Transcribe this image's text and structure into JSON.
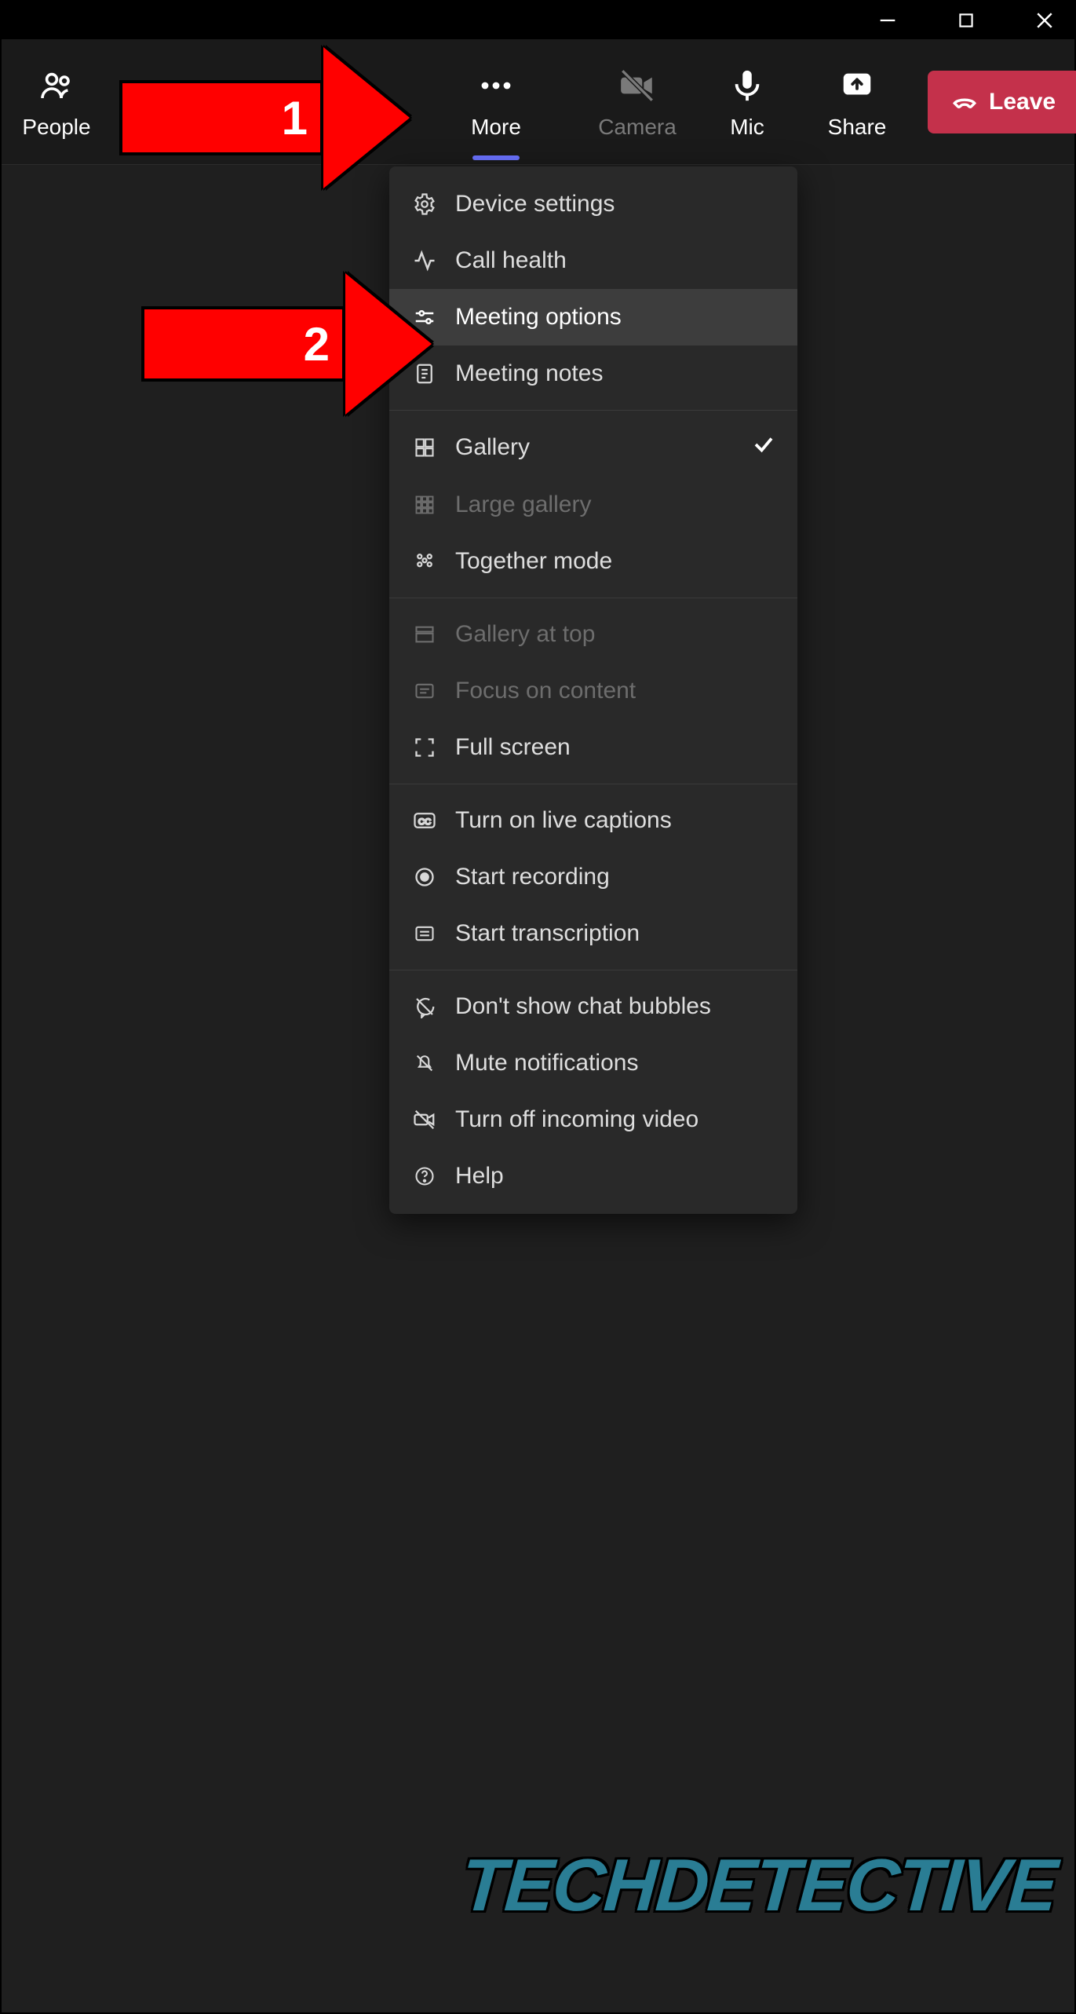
{
  "toolbar": {
    "people": "People",
    "more": "More",
    "camera": "Camera",
    "mic": "Mic",
    "share": "Share",
    "leave": "Leave"
  },
  "menu": {
    "device_settings": "Device settings",
    "call_health": "Call health",
    "meeting_options": "Meeting options",
    "meeting_notes": "Meeting notes",
    "gallery": "Gallery",
    "large_gallery": "Large gallery",
    "together_mode": "Together mode",
    "gallery_at_top": "Gallery at top",
    "focus_on_content": "Focus on content",
    "full_screen": "Full screen",
    "turn_on_live_captions": "Turn on live captions",
    "start_recording": "Start recording",
    "start_transcription": "Start transcription",
    "dont_show_chat_bubbles": "Don't show chat bubbles",
    "mute_notifications": "Mute notifications",
    "turn_off_incoming_video": "Turn off incoming video",
    "help": "Help"
  },
  "callouts": {
    "one": "1",
    "two": "2"
  },
  "watermark": "TECHDETECTIVE"
}
